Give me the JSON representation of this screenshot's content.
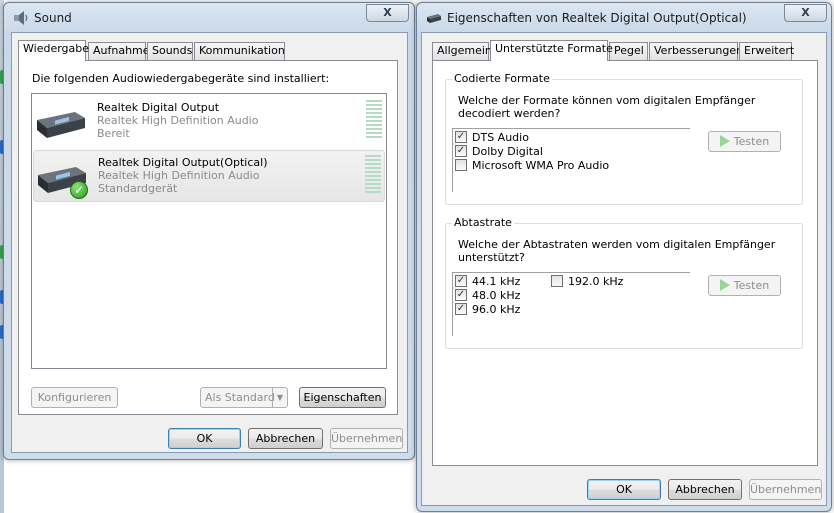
{
  "sound_window": {
    "title": "Sound",
    "close_label": "X",
    "tabs": [
      {
        "label": "Wiedergabe",
        "active": true
      },
      {
        "label": "Aufnahme",
        "active": false
      },
      {
        "label": "Sounds",
        "active": false
      },
      {
        "label": "Kommunikation",
        "active": false
      }
    ],
    "instruction": "Die folgenden Audiowiedergabegeräte sind installiert:",
    "devices": [
      {
        "name": "Realtek Digital Output",
        "driver": "Realtek High Definition Audio",
        "status": "Bereit",
        "selected": false,
        "default_badge": false
      },
      {
        "name": "Realtek Digital Output(Optical)",
        "driver": "Realtek High Definition Audio",
        "status": "Standardgerät",
        "selected": true,
        "default_badge": true
      }
    ],
    "buttons": {
      "configure": "Konfigurieren",
      "set_default": "Als Standard",
      "properties": "Eigenschaften",
      "ok": "OK",
      "cancel": "Abbrechen",
      "apply": "Übernehmen"
    }
  },
  "props_window": {
    "title": "Eigenschaften von Realtek Digital Output(Optical)",
    "close_label": "X",
    "tabs": [
      {
        "label": "Allgemein",
        "active": false
      },
      {
        "label": "Unterstützte Formate",
        "active": true
      },
      {
        "label": "Pegel",
        "active": false
      },
      {
        "label": "Verbesserungen",
        "active": false
      },
      {
        "label": "Erweitert",
        "active": false
      }
    ],
    "encoded_formats": {
      "legend": "Codierte Formate",
      "description": "Welche der Formate können vom digitalen Empfänger decodiert werden?",
      "items": [
        {
          "label": "DTS Audio",
          "checked": true
        },
        {
          "label": "Dolby Digital",
          "checked": true
        },
        {
          "label": "Microsoft WMA Pro Audio",
          "checked": false
        }
      ],
      "test_label": "Testen"
    },
    "sample_rates": {
      "legend": "Abtastrate",
      "description": "Welche der Abtastraten werden vom digitalen Empfänger unterstützt?",
      "items": [
        {
          "label": "44.1 kHz",
          "checked": true
        },
        {
          "label": "48.0 kHz",
          "checked": true
        },
        {
          "label": "96.0 kHz",
          "checked": true
        },
        {
          "label": "192.0 kHz",
          "checked": false
        }
      ],
      "test_label": "Testen"
    },
    "buttons": {
      "ok": "OK",
      "cancel": "Abbrechen",
      "apply": "Übernehmen"
    }
  },
  "colors": {
    "accent_border": "#3c7fb1",
    "window_frame": "#cfdceb",
    "check_green": "#2a9a1e",
    "disabled_text": "#8d8d8d"
  },
  "check_glyph": "✓"
}
